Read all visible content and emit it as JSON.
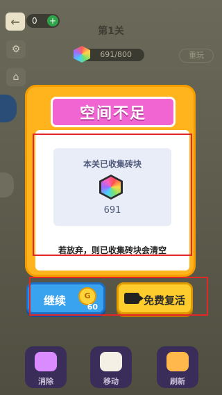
{
  "header": {
    "coins": "0",
    "level_title": "第1关",
    "progress_text": "691/800",
    "replay_label": "重玩"
  },
  "modal": {
    "title": "空间不足",
    "collect_title": "本关已收集砖块",
    "collect_count": "691",
    "warning": "若放弃，则已收集砖块会清空"
  },
  "buttons": {
    "continue_label": "继续",
    "continue_coin_icon": "G",
    "continue_cost": "60",
    "revive_label": "免费复活"
  },
  "toolbar": {
    "items": [
      {
        "label": "消除",
        "icon": "hammer-icon"
      },
      {
        "label": "移动",
        "icon": "hand-icon"
      },
      {
        "label": "刷新",
        "icon": "refresh-icon"
      }
    ]
  },
  "colors": {
    "modal_bg": "#ffb41e",
    "ribbon": "#f065d2",
    "continue_btn": "#3aa3f0",
    "revive_btn": "#ffcc2e",
    "highlight_box": "#e32626"
  }
}
